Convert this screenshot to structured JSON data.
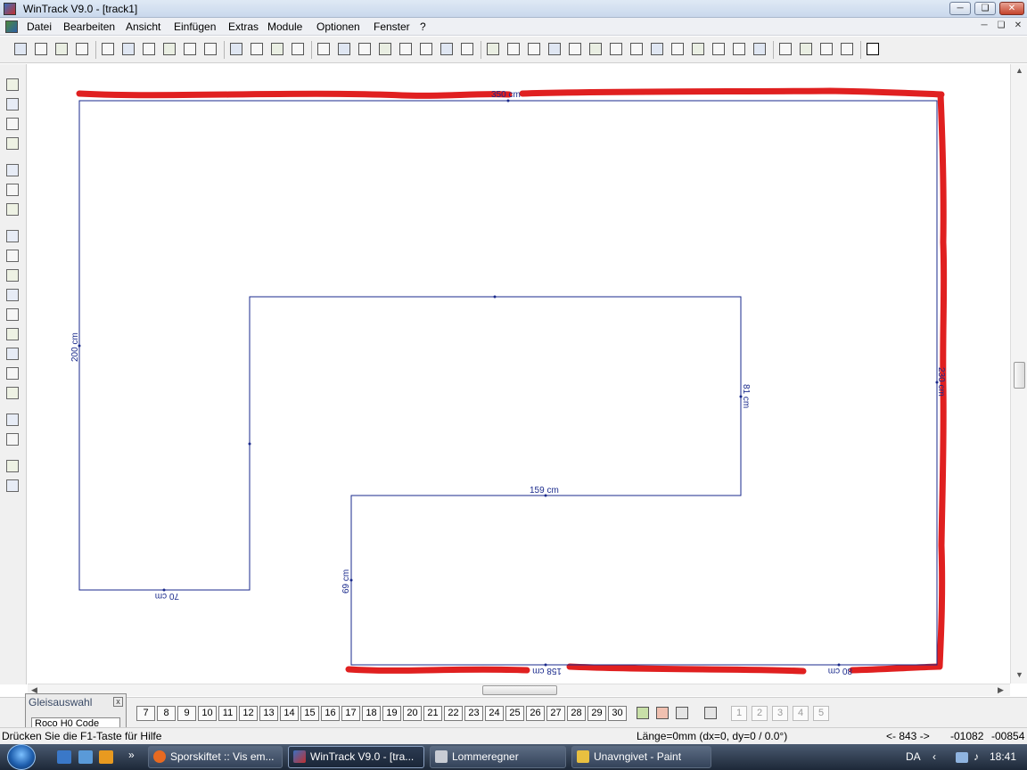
{
  "window": {
    "title": "WinTrack  V9.0 - [track1]"
  },
  "menubar": {
    "items": [
      "Datei",
      "Bearbeiten",
      "Ansicht",
      "Einfügen",
      "Extras",
      "Module",
      "Optionen",
      "Fenster",
      "?"
    ]
  },
  "toolbar": {
    "icons": [
      "new-document-icon",
      "open-folder-icon",
      "save-icon",
      "print-preview-icon",
      "print-icon",
      "print-setup-icon",
      "calculator-icon",
      "track-library-icon",
      "slider-settings-icon",
      "picture-icon",
      "zoom-out-icon",
      "zoom-in-icon",
      "zoom-window-icon",
      "zoom-fit-icon",
      "undo-icon",
      "redo-icon",
      "delete-icon",
      "copy-section-icon",
      "paste-section-icon",
      "cut-icon",
      "copy-icon",
      "paste-icon",
      "switch-track-icon",
      "curve-track-icon",
      "flex-track-icon",
      "bridge-icon",
      "group-icon",
      "ungroup-icon",
      "rotate-icon",
      "rotate-angle-icon",
      "rotate-180-icon",
      "connect-icon",
      "align-icon",
      "split-track-icon",
      "join-track-icon",
      "arrow-track-icon",
      "height-icon",
      "ramp-icon",
      "level-icon",
      "magic-icon",
      "help-icon"
    ]
  },
  "left_tools": {
    "icons": [
      "flex-track-tool-icon",
      "flex-track-tool-2-icon",
      "parallel-track-tool-icon",
      "platform-tool-icon",
      "ruler-tool-icon",
      "wall-tool-icon",
      "baseboard-tool-icon",
      "dimension-tool-icon",
      "height-mark-tool-icon",
      "text-tool-icon",
      "signal-number-tool-icon",
      "building-tool-icon",
      "trees-tool-icon",
      "stairs-tool-icon",
      "terrain-tool-icon",
      "landscape-tool-icon",
      "vertical-spacing-tool-icon",
      "height-adjust-tool-icon",
      "pen-tool-icon",
      "font-tool-icon"
    ]
  },
  "drawing": {
    "dimension_labels": {
      "top": "350 cm",
      "left": "200 cm",
      "right": "230 cm",
      "inner_right": "81 cm",
      "inner_middle": "159 cm",
      "lower_left": "69 cm",
      "bottom_left": "70 cm",
      "bottom_middle": "158 cm",
      "bottom_right": "80 cm"
    },
    "line_color": "#1a2a8c",
    "highlight_color": "#e02020"
  },
  "gleisauswahl": {
    "title": "Gleisauswahl",
    "close": "x",
    "select_value": "Roco H0 Code"
  },
  "layers": {
    "visible_numbers": [
      "7",
      "8",
      "9",
      "10",
      "11",
      "12",
      "13",
      "14",
      "15",
      "16",
      "17",
      "18",
      "19",
      "20",
      "21",
      "22",
      "23",
      "24",
      "25",
      "26",
      "27",
      "28",
      "29",
      "30"
    ],
    "right_numbers": [
      "1",
      "2",
      "3",
      "4",
      "5"
    ]
  },
  "statusbar": {
    "hint": "Drücken Sie die  F1-Taste für Hilfe",
    "length": "Länge=0mm (dx=0, dy=0 / 0.0°)",
    "navigation": "<- 843 ->",
    "coord_x": "-01082",
    "coord_y": "-00854"
  },
  "taskbar": {
    "tasks": [
      {
        "label": "Sporskiftet :: Vis em...",
        "active": false
      },
      {
        "label": "WinTrack  V9.0 - [tra...",
        "active": true
      },
      {
        "label": "Lommeregner",
        "active": false
      },
      {
        "label": "Unavngivet - Paint",
        "active": false
      }
    ],
    "language": "DA",
    "time": "18:41"
  }
}
